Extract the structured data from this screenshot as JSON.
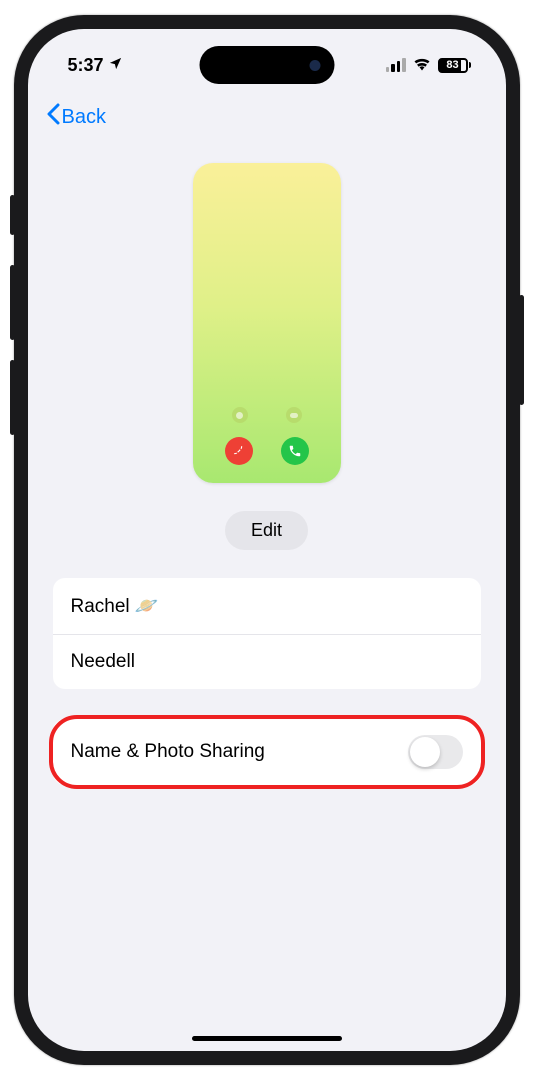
{
  "status": {
    "time": "5:37",
    "battery_percent": "83"
  },
  "nav": {
    "back_label": "Back"
  },
  "buttons": {
    "edit_label": "Edit"
  },
  "contact": {
    "first_name": "Rachel 🪐",
    "last_name": "Needell"
  },
  "sharing": {
    "label": "Name & Photo Sharing",
    "enabled": false
  }
}
